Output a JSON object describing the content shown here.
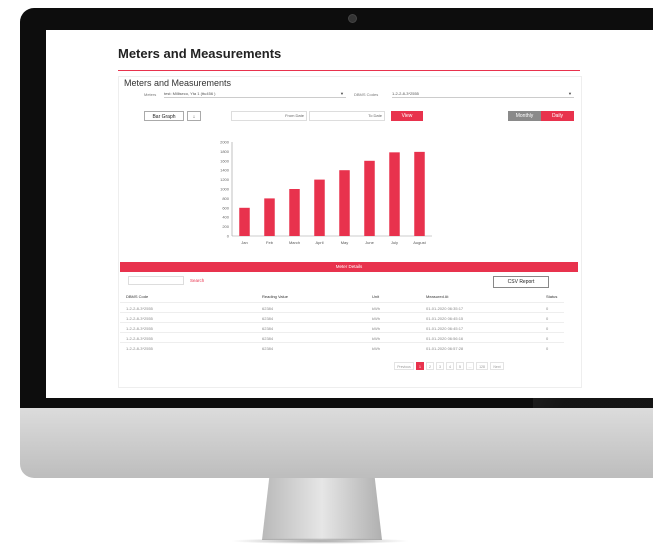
{
  "page": {
    "title": "Meters and Measurements"
  },
  "panel": {
    "title": "Meters and Measurements",
    "meter_label": "Meters",
    "meter_value": "test: Milliseco, Yta 1 (ttu456 )",
    "dmis_label": "DBMS Codes",
    "dmis_value": "1-2-2-8-3*2555"
  },
  "controls": {
    "graph_type": "Bar Graph",
    "download_icon": "download-icon",
    "from_date": "From Date",
    "to_date": "To Date",
    "view": "View",
    "monthly": "Monthly",
    "daily": "Daily"
  },
  "chart_data": {
    "type": "bar",
    "categories": [
      "Jan",
      "Feb",
      "March",
      "April",
      "May",
      "June",
      "July",
      "August"
    ],
    "values": [
      600,
      800,
      1000,
      1200,
      1400,
      1600,
      1780,
      1790
    ],
    "yticks": [
      "0",
      "200",
      "400",
      "600",
      "800",
      "1000",
      "1200",
      "1400",
      "1600",
      "1800",
      "2000"
    ],
    "ylim": [
      0,
      2000
    ],
    "color": "#e8324d"
  },
  "table": {
    "title": "Meter Details",
    "search_label": "Search",
    "csv_label": "CSV Report",
    "headers": [
      "DBMS Code",
      "Reading Value",
      "Unit",
      "Measured At",
      "Status"
    ],
    "rows": [
      [
        "1-2-2-8-3*2555",
        "62384",
        "kWh",
        "01-01-2020 06:35:17",
        "0"
      ],
      [
        "1-2-2-8-3*2555",
        "62384",
        "kWh",
        "01-01-2020 06:45:15",
        "0"
      ],
      [
        "1-2-2-8-3*2555",
        "62384",
        "kWh",
        "01-01-2020 06:45:17",
        "0"
      ],
      [
        "1-2-2-8-3*2555",
        "62384",
        "kWh",
        "01-01-2020 06:56:16",
        "0"
      ],
      [
        "1-2-2-8-3*2555",
        "62384",
        "kWh",
        "01-01-2020 06:57:28",
        "0"
      ]
    ],
    "pagination": [
      "Previous",
      "1",
      "2",
      "3",
      "4",
      "5",
      "...",
      "128",
      "Next"
    ]
  },
  "colors": {
    "accent": "#e8324d",
    "bezel": "#0d0d0d"
  }
}
